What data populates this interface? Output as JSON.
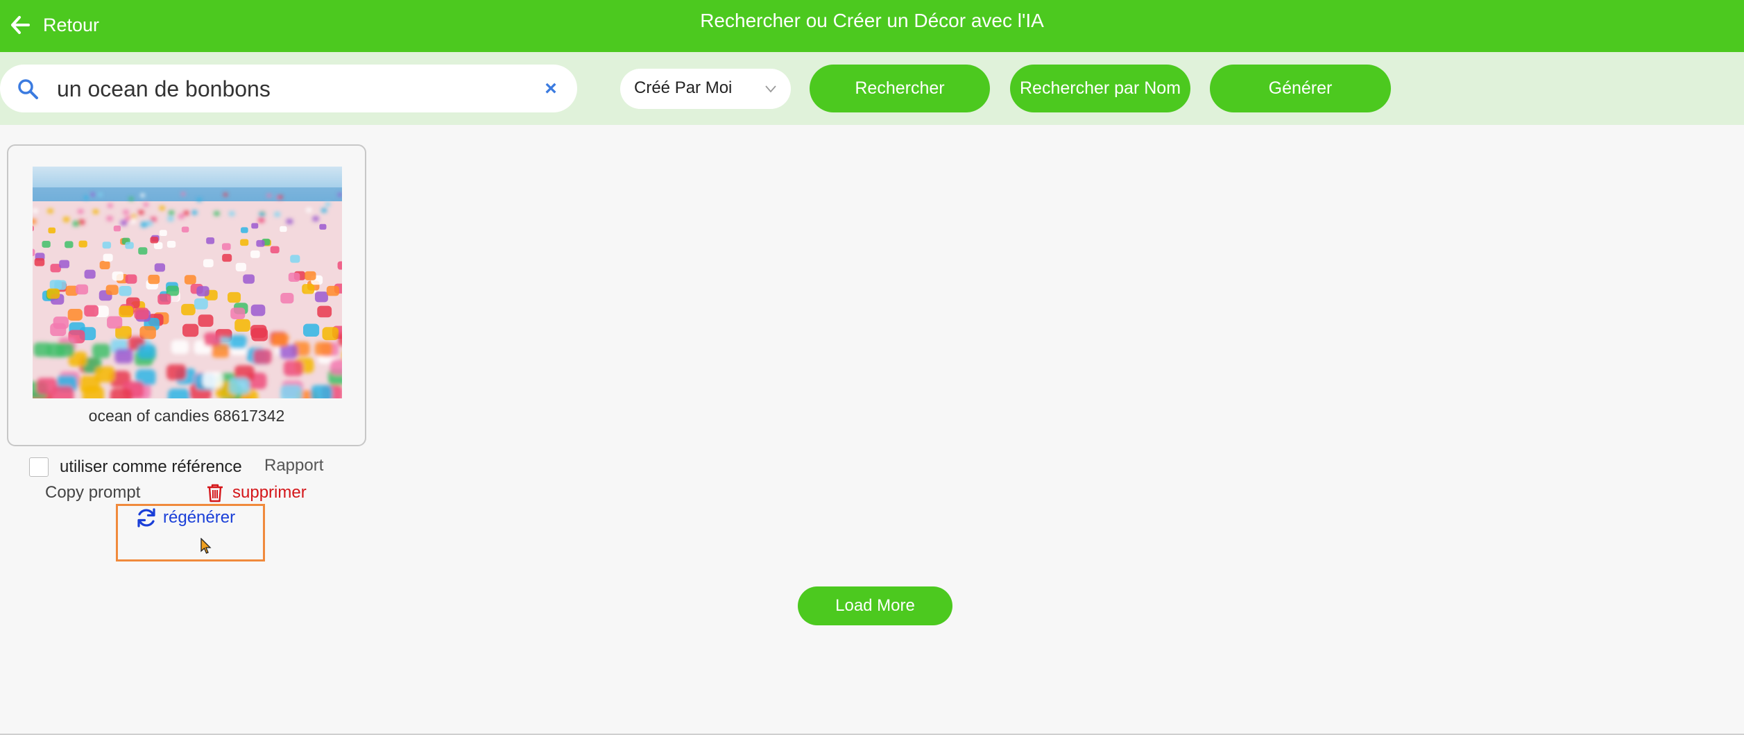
{
  "header": {
    "back_label": "Retour",
    "title": "Rechercher ou Créer un Décor avec l'IA"
  },
  "search": {
    "value": "un ocean de bonbons",
    "clear_symbol": "×",
    "filter_selected": "Créé Par Moi",
    "search_button": "Rechercher",
    "search_by_name_button": "Rechercher par Nom",
    "generate_button": "Générer"
  },
  "results": [
    {
      "caption": "ocean of candies 68617342",
      "use_as_reference_label": "utiliser comme référence",
      "use_as_reference_checked": false,
      "report_label": "Rapport",
      "copy_prompt_label": "Copy prompt",
      "delete_label": "supprimer",
      "regenerate_label": "régénérer"
    }
  ],
  "load_more_label": "Load More",
  "colors": {
    "accent_green": "#4cc91f",
    "toolbar_bg": "#e0f2da",
    "delete_red": "#d4161a",
    "regenerate_blue": "#1a3fd8",
    "highlight_orange": "#f08a3c"
  },
  "icons": {
    "back": "arrow-left-icon",
    "search": "search-icon",
    "clear": "close-icon",
    "dropdown": "chevron-down-icon",
    "delete": "trash-icon",
    "regenerate": "refresh-icon"
  }
}
